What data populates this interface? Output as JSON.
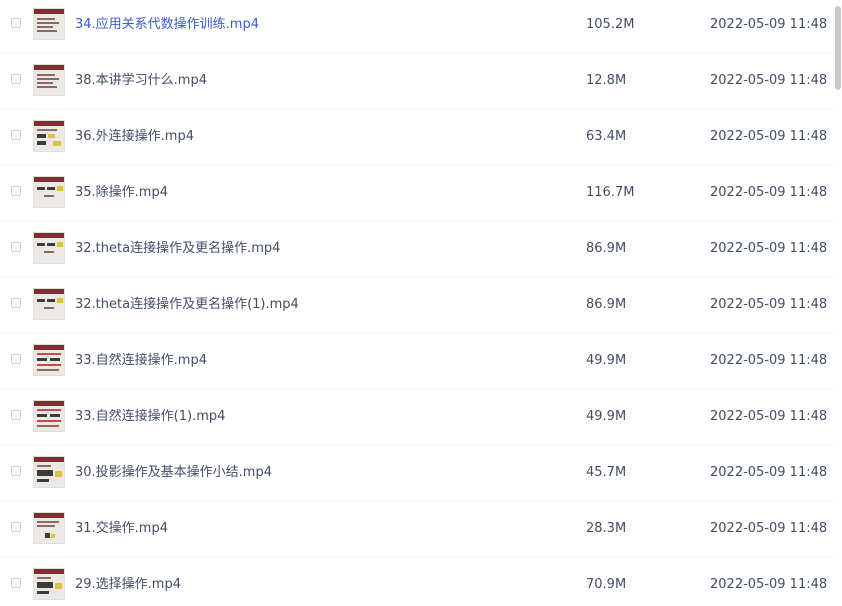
{
  "files": [
    {
      "name": "34.应用关系代数操作训练.mp4",
      "size": "105.2M",
      "date": "2022-05-09 11:48",
      "active": true,
      "thumb": "list"
    },
    {
      "name": "38.本讲学习什么.mp4",
      "size": "12.8M",
      "date": "2022-05-09 11:48",
      "active": false,
      "thumb": "list"
    },
    {
      "name": "36.外连接操作.mp4",
      "size": "63.4M",
      "date": "2022-05-09 11:48",
      "active": false,
      "thumb": "tables"
    },
    {
      "name": "35.除操作.mp4",
      "size": "116.7M",
      "date": "2022-05-09 11:48",
      "active": false,
      "thumb": "sparse"
    },
    {
      "name": "32.theta连接操作及更名操作.mp4",
      "size": "86.9M",
      "date": "2022-05-09 11:48",
      "active": false,
      "thumb": "sparse"
    },
    {
      "name": "32.theta连接操作及更名操作(1).mp4",
      "size": "86.9M",
      "date": "2022-05-09 11:48",
      "active": false,
      "thumb": "sparse"
    },
    {
      "name": "33.自然连接操作.mp4",
      "size": "49.9M",
      "date": "2022-05-09 11:48",
      "active": false,
      "thumb": "red"
    },
    {
      "name": "33.自然连接操作(1).mp4",
      "size": "49.9M",
      "date": "2022-05-09 11:48",
      "active": false,
      "thumb": "red"
    },
    {
      "name": "30.投影操作及基本操作小结.mp4",
      "size": "45.7M",
      "date": "2022-05-09 11:48",
      "active": false,
      "thumb": "dark"
    },
    {
      "name": "31.交操作.mp4",
      "size": "28.3M",
      "date": "2022-05-09 11:48",
      "active": false,
      "thumb": "small"
    },
    {
      "name": "29.选择操作.mp4",
      "size": "70.9M",
      "date": "2022-05-09 11:48",
      "active": false,
      "thumb": "dark"
    }
  ],
  "colors": {
    "text": "#424e67",
    "active_text": "#3d5bd1",
    "divider": "#f1f2f4",
    "thumb_header": "#7a2e2e"
  },
  "icons": {
    "checkbox": "checkbox-icon",
    "thumbnail": "video-thumbnail-icon"
  }
}
